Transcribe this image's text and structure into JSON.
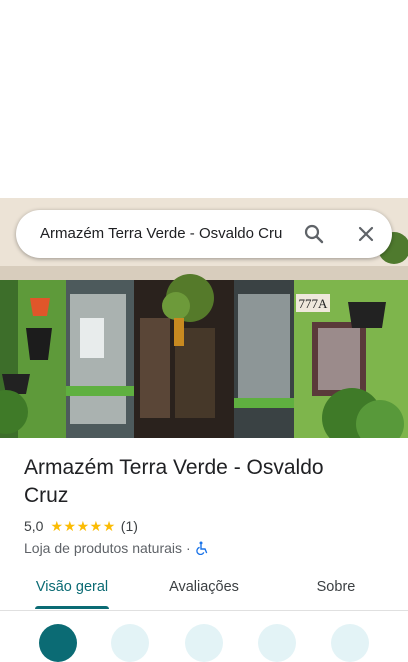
{
  "search": {
    "query": "Armazém Terra Verde - Osvaldo Cru",
    "search_icon": "search-icon",
    "close_icon": "close-icon"
  },
  "place": {
    "name": "Armazém Terra Verde - Osvaldo Cruz",
    "rating": "5,0",
    "stars": 5,
    "review_count": "(1)",
    "category": "Loja de produtos naturais",
    "separator": "·",
    "accessibility_icon": "wheelchair-icon",
    "photo_sign": "777A"
  },
  "tabs": [
    {
      "label": "Visão geral",
      "active": true
    },
    {
      "label": "Avaliações",
      "active": false
    },
    {
      "label": "Sobre",
      "active": false
    }
  ],
  "colors": {
    "accent": "#0b6b74",
    "star": "#fbbc04",
    "action_secondary": "#e3f3f6"
  }
}
